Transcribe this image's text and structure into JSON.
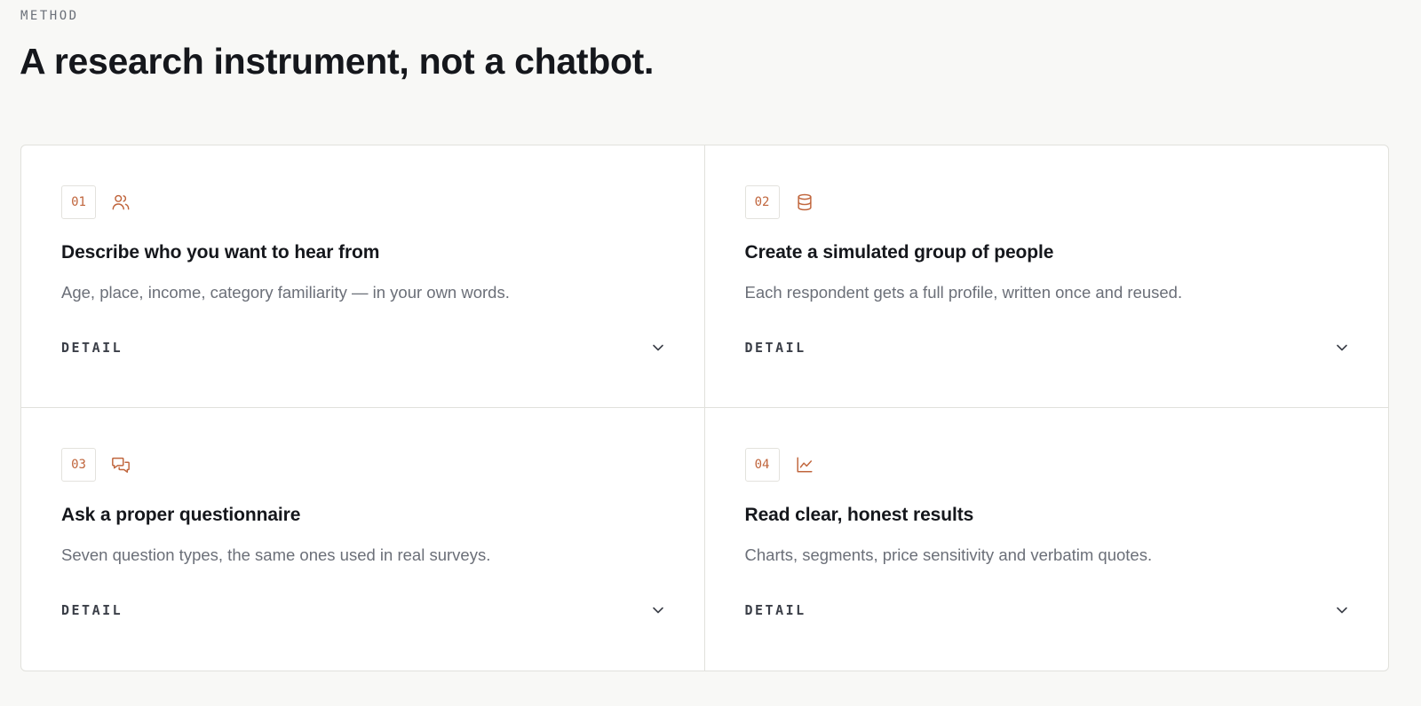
{
  "section": {
    "eyebrow": "METHOD",
    "headline": "A research instrument, not a chatbot."
  },
  "colors": {
    "accent": "#c0653c",
    "background": "#f8f8f6",
    "card_background": "#ffffff",
    "border": "#e1e1dc"
  },
  "cards": [
    {
      "number": "01",
      "icon": "users-icon",
      "title": "Describe who you want to hear from",
      "description": "Age, place, income, category familiarity — in your own words.",
      "detail_label": "DETAIL",
      "expanded": false
    },
    {
      "number": "02",
      "icon": "database-icon",
      "title": "Create a simulated group of people",
      "description": "Each respondent gets a full profile, written once and reused.",
      "detail_label": "DETAIL",
      "expanded": false
    },
    {
      "number": "03",
      "icon": "chat-bubbles-icon",
      "title": "Ask a proper questionnaire",
      "description": "Seven question types, the same ones used in real surveys.",
      "detail_label": "DETAIL",
      "expanded": false
    },
    {
      "number": "04",
      "icon": "line-chart-icon",
      "title": "Read clear, honest results",
      "description": "Charts, segments, price sensitivity and verbatim quotes.",
      "detail_label": "DETAIL",
      "expanded": false
    }
  ]
}
